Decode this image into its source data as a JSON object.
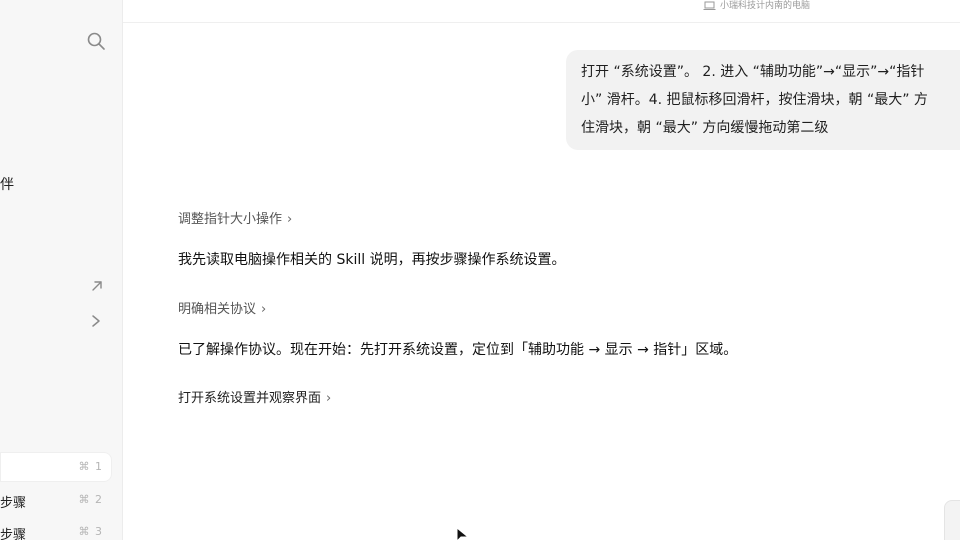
{
  "sidebar": {
    "fragment_text": "伴",
    "items": [
      {
        "label": "",
        "shortcut": "⌘ 1",
        "active": true
      },
      {
        "label": "步骤",
        "shortcut": "⌘ 2",
        "active": false
      },
      {
        "label": "步骤",
        "shortcut": "⌘ 3",
        "active": false
      }
    ]
  },
  "header": {
    "device_label": "小瑞科技计内南的电脑"
  },
  "conversation": {
    "user_message_lines": [
      "打开 “系统设置”。 2. 进入 “辅助功能”→“显示”→“指针",
      "小” 滑杆。4. 把鼠标移回滑杆，按住滑块，朝 “最大” 方",
      "住滑块，朝 “最大” 方向缓慢拖动第二级"
    ],
    "step1": "调整指针大小操作",
    "reply1": "我先读取电脑操作相关的 Skill 说明，再按步骤操作系统设置。",
    "step2": "明确相关协议",
    "reply2": "已了解操作协议。现在开始：先打开系统设置，定位到「辅助功能 → 显示 → 指针」区域。",
    "step3": "打开系统设置并观察界面"
  },
  "icons": {
    "search": "search-icon",
    "external": "arrow-up-right-icon",
    "chevron": "chevron-right-icon",
    "device": "laptop-icon"
  }
}
